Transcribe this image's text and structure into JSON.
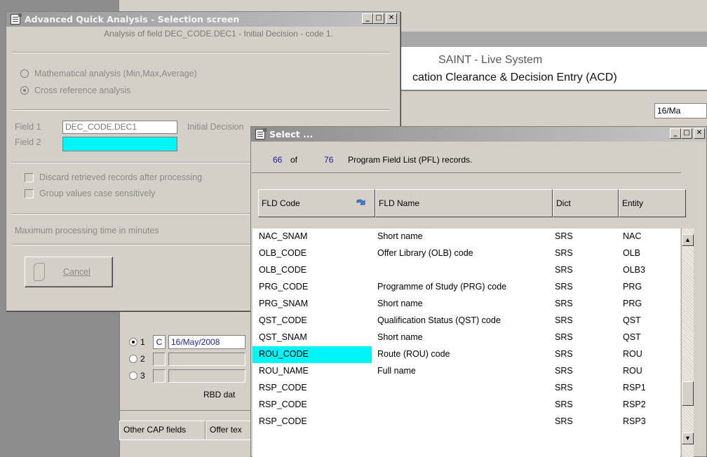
{
  "background_window": {
    "system_name": "SAINT - Live System",
    "form_title": "cation Clearance & Decision Entry (ACD)",
    "date_value": "16/Ma",
    "rows": [
      {
        "num": "1",
        "selected": true,
        "code": "C",
        "date": "16/May/2008"
      },
      {
        "num": "2",
        "selected": false,
        "code": "",
        "date": ""
      },
      {
        "num": "3",
        "selected": false,
        "code": "",
        "date": ""
      }
    ],
    "rbd_label": "RBD dat",
    "tabs": [
      "Other CAP fields",
      "Offer tex"
    ]
  },
  "aqa_window": {
    "title": "Advanced Quick Analysis - Selection screen",
    "subtitle": "Analysis of field DEC_CODE.DEC1 - Initial Decision - code 1.",
    "radio_options": [
      {
        "label": "Mathematical analysis (Min,Max,Average)",
        "selected": false
      },
      {
        "label": "Cross reference analysis",
        "selected": true
      }
    ],
    "field1_label": "Field 1",
    "field1_value": "DEC_CODE.DEC1",
    "field1_desc": "Initial Decision",
    "field2_label": "Field 2",
    "field2_value": "",
    "checkboxes": [
      {
        "label": "Discard retrieved records after processing",
        "checked": false
      },
      {
        "label": "Group values case sensitively",
        "checked": false
      }
    ],
    "max_time_label": "Maximum processing time in minutes",
    "cancel_label": "Cancel"
  },
  "select_window": {
    "title": "Select ...",
    "count_shown": "66",
    "of_label": "of",
    "count_total": "76",
    "count_desc": "Program Field List (PFL) records.",
    "columns": [
      "FLD Code",
      "FLD Name",
      "Dict",
      "Entity"
    ],
    "rows": [
      {
        "code": "NAC_SNAM",
        "name": "Short name",
        "dict": "SRS",
        "entity": "NAC"
      },
      {
        "code": "OLB_CODE",
        "name": "Offer Library (OLB) code",
        "dict": "SRS",
        "entity": "OLB"
      },
      {
        "code": "OLB_CODE",
        "name": "",
        "dict": "SRS",
        "entity": "OLB3"
      },
      {
        "code": "PRG_CODE",
        "name": "Programme of Study (PRG) code",
        "dict": "SRS",
        "entity": "PRG"
      },
      {
        "code": "PRG_SNAM",
        "name": "Short name",
        "dict": "SRS",
        "entity": "PRG"
      },
      {
        "code": "QST_CODE",
        "name": "Qualification Status (QST) code",
        "dict": "SRS",
        "entity": "QST"
      },
      {
        "code": "QST_SNAM",
        "name": "Short name",
        "dict": "SRS",
        "entity": "QST"
      },
      {
        "code": "ROU_CODE",
        "name": "Route (ROU) code",
        "dict": "SRS",
        "entity": "ROU",
        "highlighted": true
      },
      {
        "code": "ROU_NAME",
        "name": "Full name",
        "dict": "SRS",
        "entity": "ROU"
      },
      {
        "code": "RSP_CODE",
        "name": "",
        "dict": "SRS",
        "entity": "RSP1"
      },
      {
        "code": "RSP_CODE",
        "name": "",
        "dict": "SRS",
        "entity": "RSP2"
      },
      {
        "code": "RSP_CODE",
        "name": "",
        "dict": "SRS",
        "entity": "RSP3"
      }
    ]
  },
  "colors": {
    "highlight": "#00f6f6",
    "face": "#d4d0c8",
    "count_blue": "#1c1c9c"
  }
}
